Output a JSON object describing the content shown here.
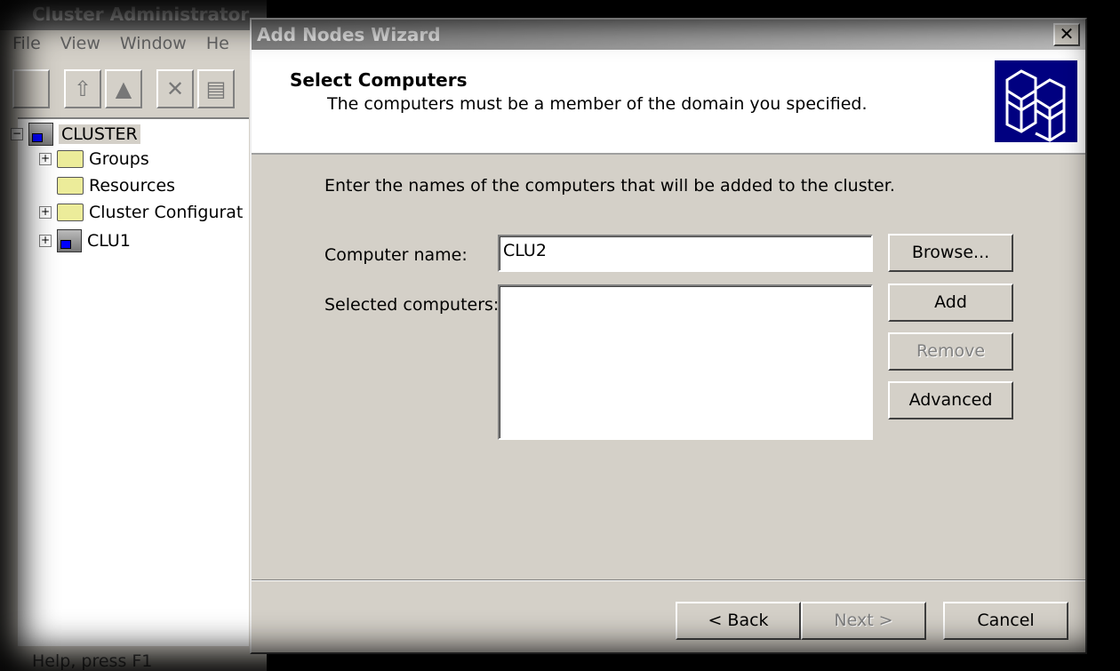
{
  "background_window": {
    "title": "Cluster Administrator",
    "menu": [
      "File",
      "View",
      "Window",
      "He"
    ],
    "tree": [
      {
        "label": "CLUSTER",
        "icon": "cluster-icon"
      },
      {
        "label": "Groups",
        "icon": "folder-icon"
      },
      {
        "label": "Resources",
        "icon": "folder-icon"
      },
      {
        "label": "Cluster Configurat",
        "icon": "folder-icon"
      },
      {
        "label": "CLU1",
        "icon": "server-icon"
      }
    ],
    "status": "Help, press F1"
  },
  "dialog": {
    "title": "Add Nodes Wizard",
    "header_title": "Select Computers",
    "header_subtitle": "The computers must be a member of the domain you specified.",
    "instruction": "Enter the names of the computers that will be added to the cluster.",
    "computer_name_label": "Computer name:",
    "computer_name_value": "CLU2",
    "selected_label": "Selected computers:",
    "buttons": {
      "browse": "Browse...",
      "add": "Add",
      "remove": "Remove",
      "advanced": "Advanced",
      "back": "< Back",
      "next": "Next >",
      "cancel": "Cancel"
    }
  },
  "colors": {
    "dialog_bg": "#d4d0c8",
    "logo_bg": "#000080"
  }
}
